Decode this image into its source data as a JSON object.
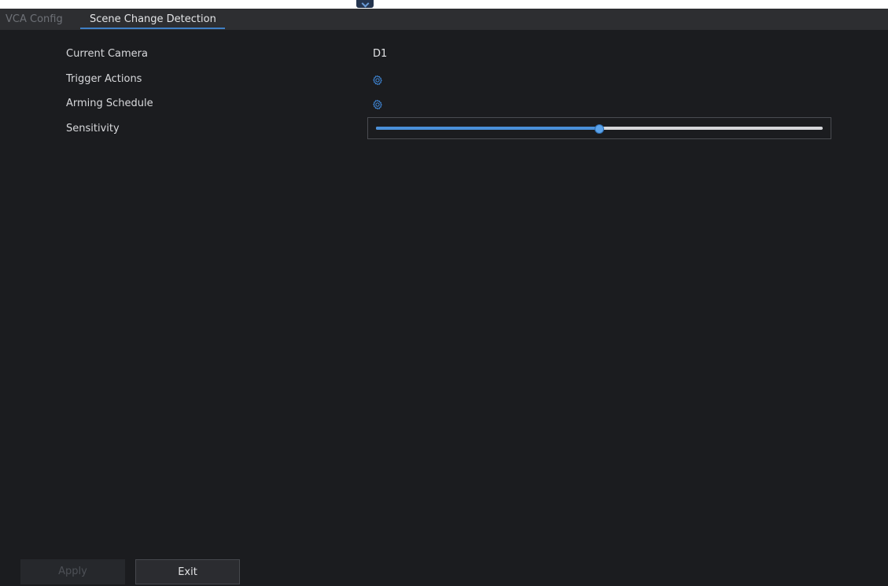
{
  "tabs": [
    {
      "label": "VCA Config",
      "active": false
    },
    {
      "label": "Scene Change Detection",
      "active": true
    }
  ],
  "form": {
    "current_camera_label": "Current Camera",
    "current_camera_value": "D1",
    "trigger_actions_label": "Trigger Actions",
    "trigger_actions_icon": "gear-icon",
    "arming_schedule_label": "Arming Schedule",
    "arming_schedule_icon": "gear-icon",
    "sensitivity_label": "Sensitivity",
    "sensitivity_fraction": 0.5
  },
  "buttons": {
    "apply_label": "Apply",
    "apply_enabled": false,
    "exit_label": "Exit"
  },
  "colors": {
    "accent": "#4a90d9",
    "panel_bg": "#1b1c1f",
    "tabbar_bg": "#2d2e31"
  }
}
